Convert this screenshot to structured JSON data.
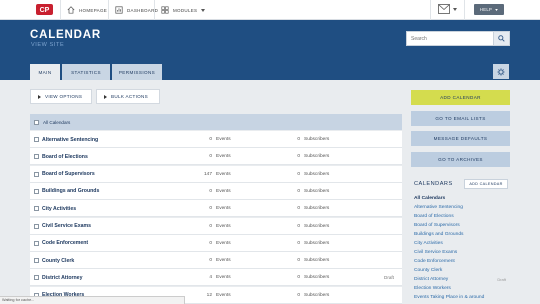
{
  "topbar": {
    "nav": [
      {
        "label": "HOMEPAGE",
        "icon": "home-icon"
      },
      {
        "label": "DASHBOARD",
        "icon": "dashboard-icon"
      },
      {
        "label": "MODULES",
        "icon": "modules-icon"
      }
    ],
    "help_label": "HELP"
  },
  "header": {
    "title": "CALENDAR",
    "subtitle": "VIEW SITE",
    "search_placeholder": "Search"
  },
  "tabs": [
    {
      "label": "MAIN",
      "active": true
    },
    {
      "label": "STATISTICS",
      "active": false
    },
    {
      "label": "PERMISSIONS",
      "active": false
    }
  ],
  "options": {
    "view_label": "VIEW OPTIONS",
    "bulk_label": "BULK ACTIONS"
  },
  "table": {
    "header": "All Calendars",
    "rows": [
      {
        "name": "Alternative Sentencing",
        "events": "0",
        "events_label": "Events",
        "subscribers": "0",
        "subscribers_label": "Subscribers",
        "status": ""
      },
      {
        "name": "Board of Elections",
        "events": "0",
        "events_label": "Events",
        "subscribers": "0",
        "subscribers_label": "Subscribers",
        "status": ""
      },
      {
        "name": "Board of Supervisors",
        "events": "147",
        "events_label": "Events",
        "subscribers": "0",
        "subscribers_label": "Subscribers",
        "status": ""
      },
      {
        "name": "Buildings and Grounds",
        "events": "0",
        "events_label": "Events",
        "subscribers": "0",
        "subscribers_label": "Subscribers",
        "status": ""
      },
      {
        "name": "City Activities",
        "events": "0",
        "events_label": "Events",
        "subscribers": "0",
        "subscribers_label": "Subscribers",
        "status": ""
      },
      {
        "name": "Civil Service Exams",
        "events": "0",
        "events_label": "Events",
        "subscribers": "0",
        "subscribers_label": "Subscribers",
        "status": ""
      },
      {
        "name": "Code Enforcement",
        "events": "0",
        "events_label": "Events",
        "subscribers": "0",
        "subscribers_label": "Subscribers",
        "status": ""
      },
      {
        "name": "County Clerk",
        "events": "0",
        "events_label": "Events",
        "subscribers": "0",
        "subscribers_label": "Subscribers",
        "status": ""
      },
      {
        "name": "District Attorney",
        "events": "4",
        "events_label": "Events",
        "subscribers": "0",
        "subscribers_label": "Subscribers",
        "status": "Draft"
      },
      {
        "name": "Election Workers",
        "events": "12",
        "events_label": "Events",
        "subscribers": "0",
        "subscribers_label": "Subscribers",
        "status": ""
      }
    ]
  },
  "actions": {
    "add_calendar": "ADD CALENDAR",
    "email_lists": "GO TO EMAIL LISTS",
    "message_defaults": "MESSAGE DEFAULTS",
    "archives": "GO TO ARCHIVES"
  },
  "sidebar": {
    "heading": "CALENDARS",
    "add_label": "ADD CALENDAR",
    "items": [
      {
        "label": "All Calendars",
        "active": true,
        "badge": ""
      },
      {
        "label": "Alternative Sentencing",
        "active": false,
        "badge": ""
      },
      {
        "label": "Board of Elections",
        "active": false,
        "badge": ""
      },
      {
        "label": "Board of Supervisors",
        "active": false,
        "badge": ""
      },
      {
        "label": "Buildings and Grounds",
        "active": false,
        "badge": ""
      },
      {
        "label": "City Activities",
        "active": false,
        "badge": ""
      },
      {
        "label": "Civil Service Exams",
        "active": false,
        "badge": ""
      },
      {
        "label": "Code Enforcement",
        "active": false,
        "badge": ""
      },
      {
        "label": "County Clerk",
        "active": false,
        "badge": ""
      },
      {
        "label": "District Attorney",
        "active": false,
        "badge": "Draft"
      },
      {
        "label": "Election Workers",
        "active": false,
        "badge": ""
      },
      {
        "label": "Events Taking Place in & around",
        "active": false,
        "badge": ""
      }
    ]
  },
  "status_text": "Waiting for cache...",
  "colors": {
    "header_bg": "#1f4e82",
    "accent_yellow": "#d4dc4e",
    "action_blue": "#bccde0",
    "logo_red": "#c8202f"
  }
}
